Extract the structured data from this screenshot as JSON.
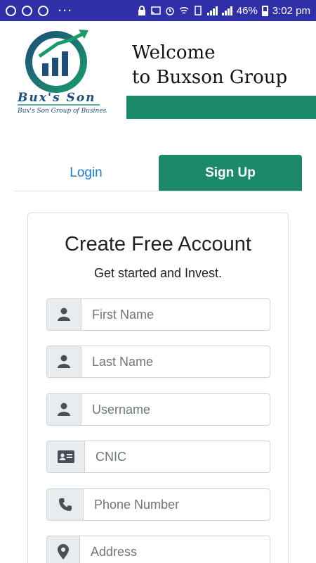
{
  "status_bar": {
    "battery": "46%",
    "time": "3:02 pm",
    "overflow": "···"
  },
  "header": {
    "logo_text": "Bux's Son",
    "logo_tagline": "Bux's Son Group of Businesses",
    "welcome_line1": "Welcome",
    "welcome_line2": "to Buxson Group"
  },
  "tabs": {
    "login": "Login",
    "signup": "Sign Up"
  },
  "form": {
    "title": "Create Free Account",
    "subtitle": "Get started and Invest.",
    "fields": [
      {
        "placeholder": "First Name",
        "icon": "user-icon"
      },
      {
        "placeholder": "Last Name",
        "icon": "user-icon"
      },
      {
        "placeholder": "Username",
        "icon": "user-icon"
      },
      {
        "placeholder": "CNIC",
        "icon": "id-card-icon"
      },
      {
        "placeholder": "Phone Number",
        "icon": "phone-icon"
      },
      {
        "placeholder": "Address",
        "icon": "map-marker-icon"
      }
    ]
  },
  "colors": {
    "status_bar": "#2f2fa8",
    "brand_green": "#1b8a6b",
    "link_blue": "#1e7bd6",
    "addon_bg": "#e9ecef"
  }
}
